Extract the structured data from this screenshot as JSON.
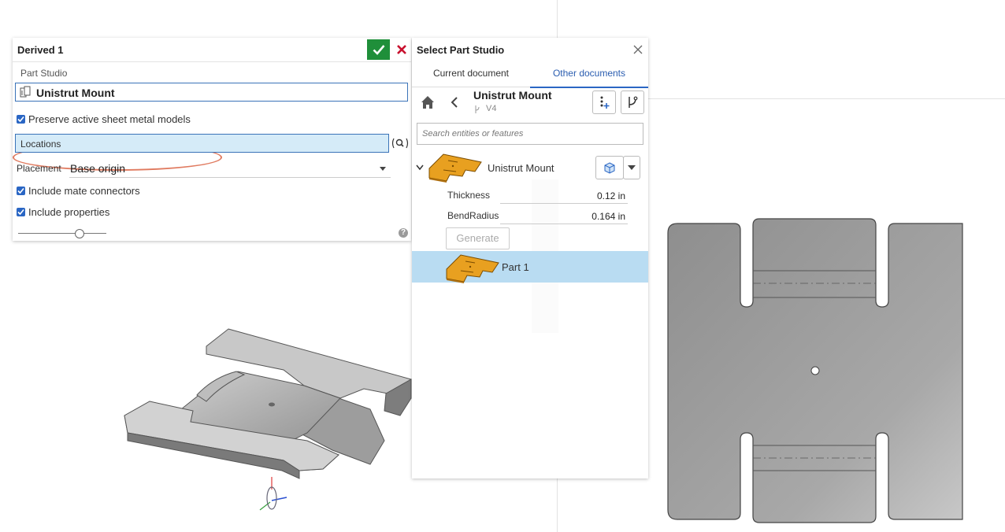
{
  "feature_dialog": {
    "title": "Derived 1",
    "part_studio_label": "Part Studio",
    "part_studio_value": "Unistrut Mount",
    "preserve_label": "Preserve active sheet metal models",
    "locations_label": "Locations",
    "placement_label": "Placement",
    "placement_value": "Base origin",
    "include_mate_label": "Include mate connectors",
    "include_props_label": "Include properties",
    "help_glyph": "?"
  },
  "select_panel": {
    "title": "Select Part Studio",
    "tabs": [
      "Current document",
      "Other documents"
    ],
    "active_tab": "Other documents",
    "document_name": "Unistrut Mount",
    "document_version": "V4",
    "search_placeholder": "Search entities or features",
    "tree_item": "Unistrut Mount",
    "params": [
      {
        "label": "Thickness",
        "value": "0.12 in"
      },
      {
        "label": "BendRadius",
        "value": "0.164 in"
      }
    ],
    "generate_label": "Generate",
    "part_label": "Part 1"
  },
  "colors": {
    "accent": "#2a66c4",
    "ok_green": "#1f8f3a",
    "cancel_red": "#c8102e",
    "highlight": "#e07a5f",
    "selection": "#b9dcf2",
    "part_orange": "#e8a020"
  }
}
